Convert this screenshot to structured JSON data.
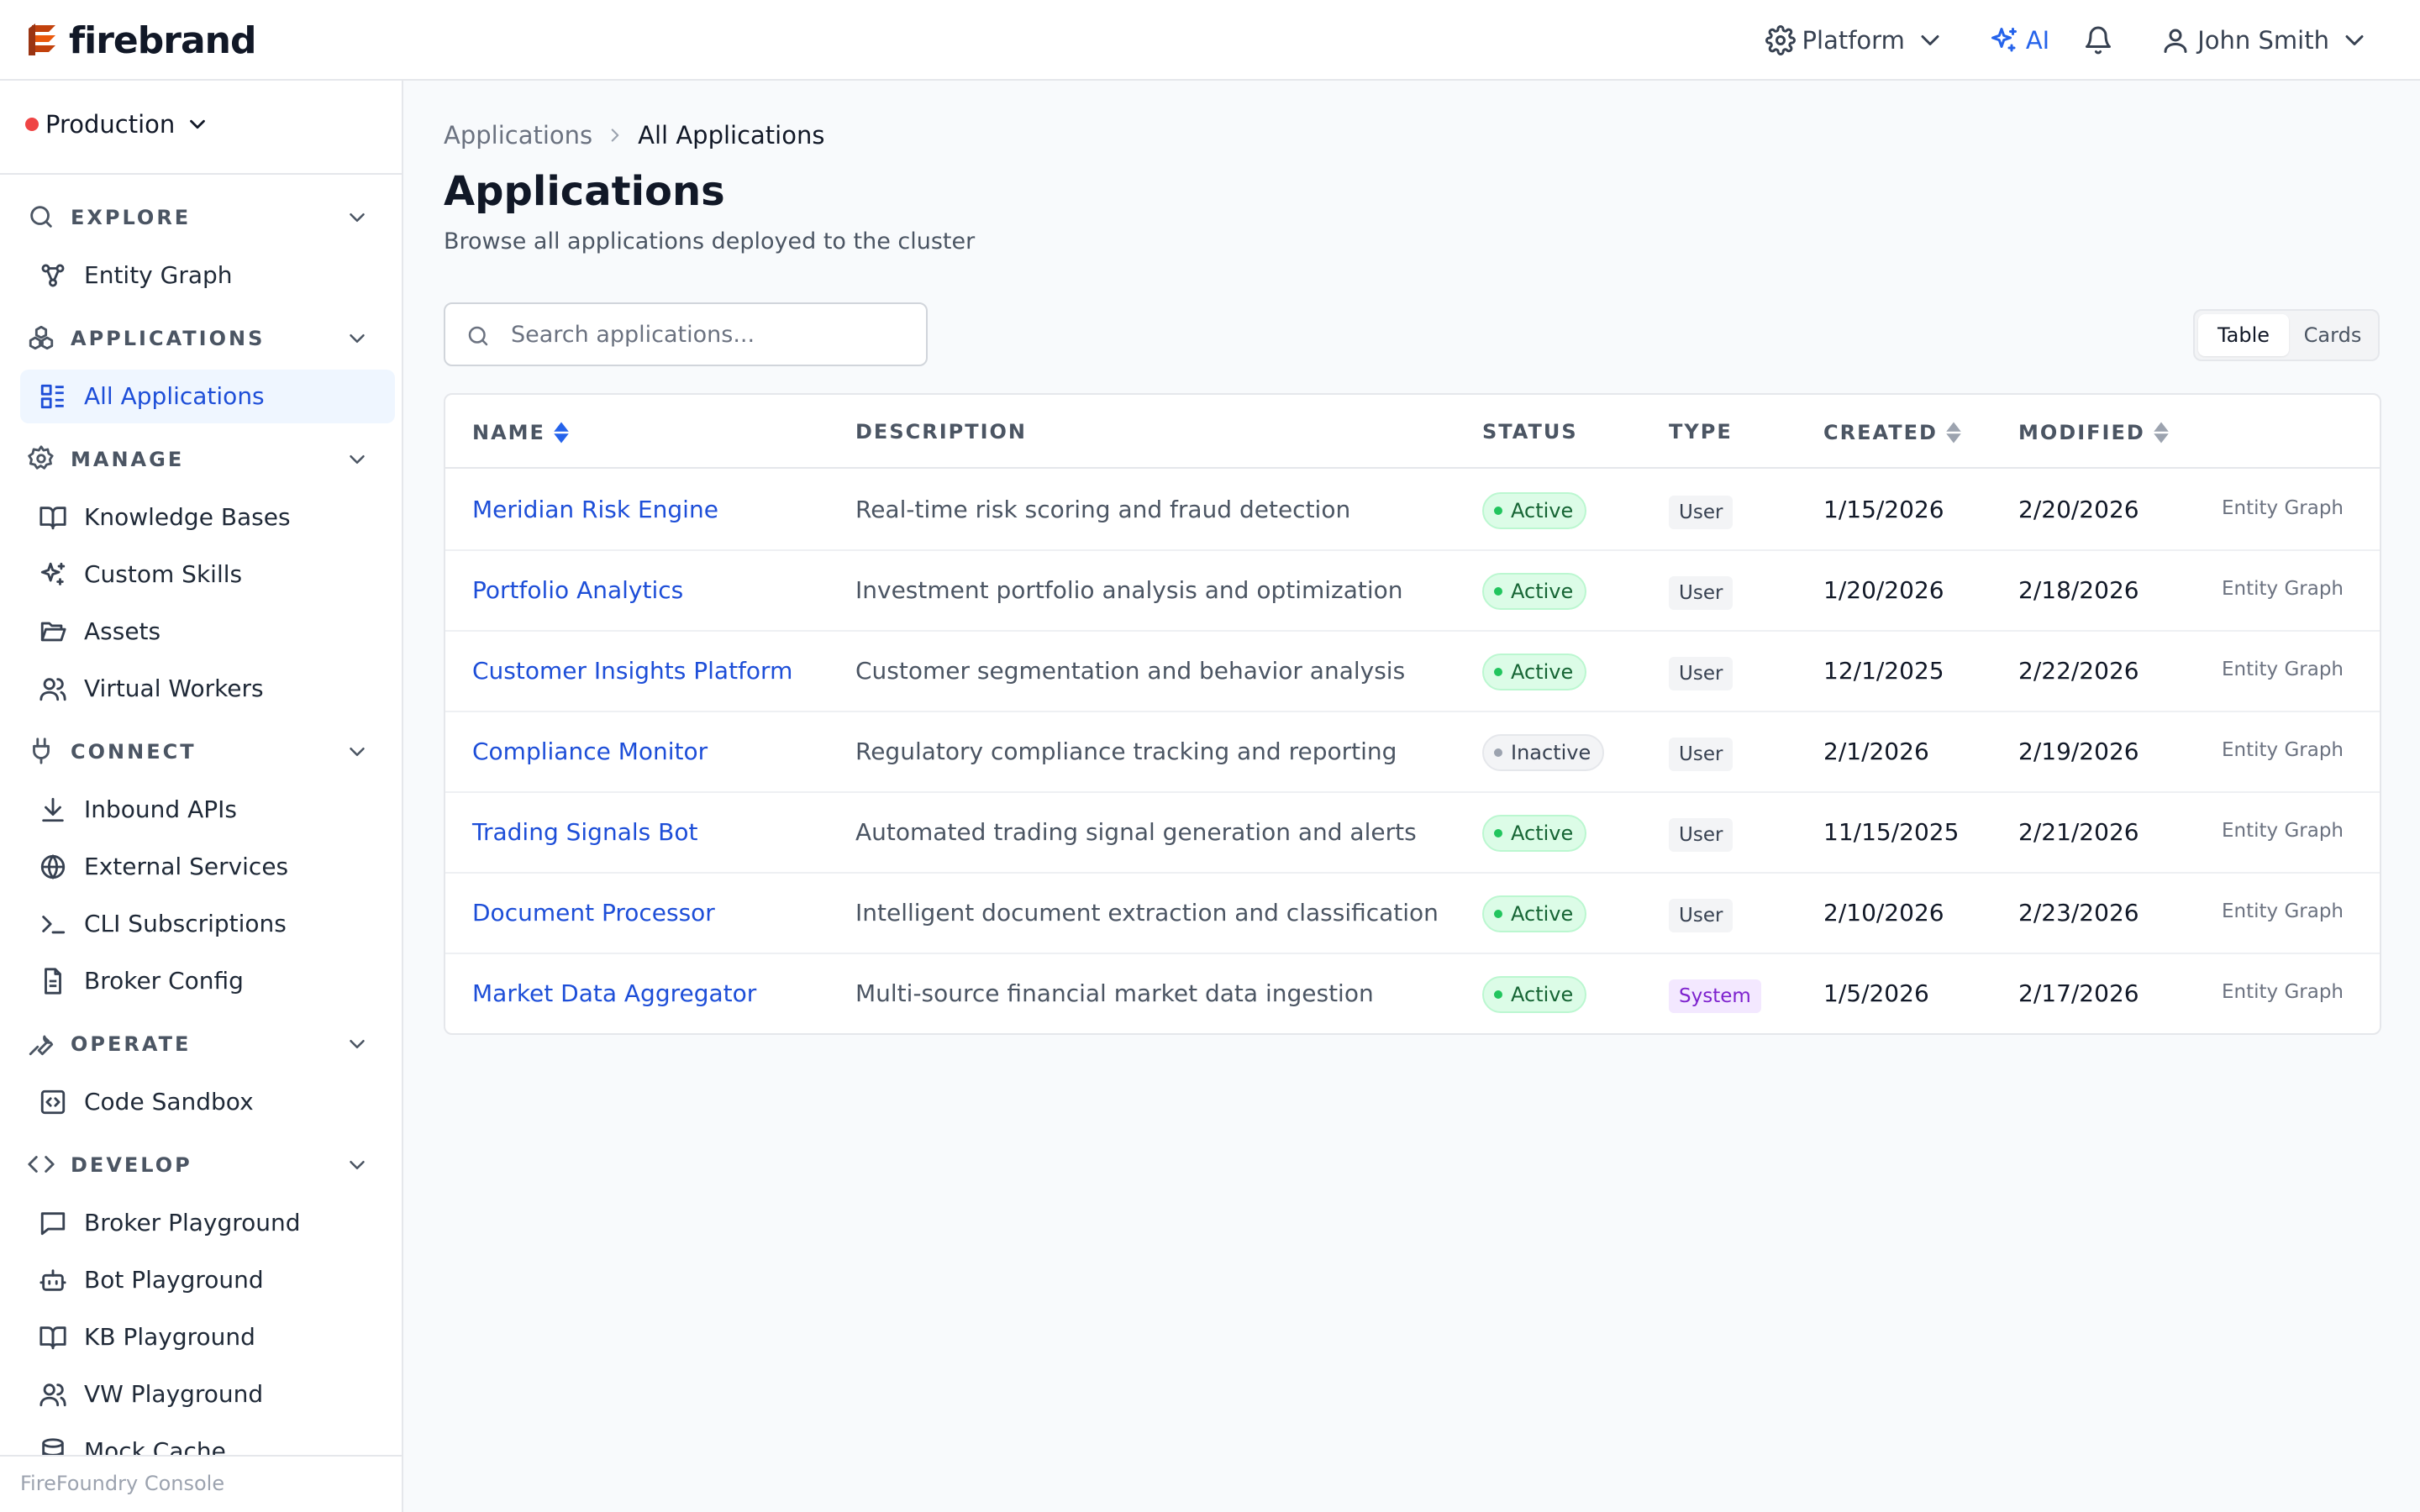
{
  "header": {
    "logo_text": "firebrand",
    "platform_label": "Platform",
    "ai_label": "AI",
    "user_name": "John Smith",
    "accent_color": "#2563eb",
    "logo_color": "#c2410c"
  },
  "sidebar": {
    "environment": "Production",
    "environment_status_color": "#ef4444",
    "sections": {
      "explore": "EXPLORE",
      "applications": "APPLICATIONS",
      "manage": "MANAGE",
      "connect": "CONNECT",
      "operate": "OPERATE",
      "develop": "DEVELOP"
    },
    "items": {
      "entity_graph": "Entity Graph",
      "all_applications": "All Applications",
      "knowledge_bases": "Knowledge Bases",
      "custom_skills": "Custom Skills",
      "assets": "Assets",
      "virtual_workers": "Virtual Workers",
      "inbound_apis": "Inbound APIs",
      "external_services": "External Services",
      "cli_subscriptions": "CLI Subscriptions",
      "broker_config": "Broker Config",
      "code_sandbox": "Code Sandbox",
      "broker_playground": "Broker Playground",
      "bot_playground": "Bot Playground",
      "kb_playground": "KB Playground",
      "vw_playground": "VW Playground",
      "mock_cache": "Mock Cache"
    },
    "footer": "FireFoundry Console"
  },
  "main": {
    "breadcrumb": [
      "Applications",
      "All Applications"
    ],
    "title": "Applications",
    "subtitle": "Browse all applications deployed to the cluster",
    "search_placeholder": "Search applications...",
    "view_toggle": {
      "table": "Table",
      "cards": "Cards",
      "selected": "Table"
    },
    "table": {
      "columns": {
        "name": "NAME",
        "description": "DESCRIPTION",
        "status": "STATUS",
        "type": "TYPE",
        "created": "CREATED",
        "modified": "MODIFIED"
      },
      "sort": {
        "column": "NAME",
        "direction": "ascending"
      },
      "rows": [
        {
          "name": "Meridian Risk Engine",
          "description": "Real-time risk scoring and fraud detection",
          "status": "Active",
          "type": "User",
          "created": "1/15/2026",
          "modified": "2/20/2026",
          "link": "Entity Graph"
        },
        {
          "name": "Portfolio Analytics",
          "description": "Investment portfolio analysis and optimization",
          "status": "Active",
          "type": "User",
          "created": "1/20/2026",
          "modified": "2/18/2026",
          "link": "Entity Graph"
        },
        {
          "name": "Customer Insights Platform",
          "description": "Customer segmentation and behavior analysis",
          "status": "Active",
          "type": "User",
          "created": "12/1/2025",
          "modified": "2/22/2026",
          "link": "Entity Graph"
        },
        {
          "name": "Compliance Monitor",
          "description": "Regulatory compliance tracking and reporting",
          "status": "Inactive",
          "type": "User",
          "created": "2/1/2026",
          "modified": "2/19/2026",
          "link": "Entity Graph"
        },
        {
          "name": "Trading Signals Bot",
          "description": "Automated trading signal generation and alerts",
          "status": "Active",
          "type": "User",
          "created": "11/15/2025",
          "modified": "2/21/2026",
          "link": "Entity Graph"
        },
        {
          "name": "Document Processor",
          "description": "Intelligent document extraction and classification",
          "status": "Active",
          "type": "User",
          "created": "2/10/2026",
          "modified": "2/23/2026",
          "link": "Entity Graph"
        },
        {
          "name": "Market Data Aggregator",
          "description": "Multi-source financial market data ingestion",
          "status": "Active",
          "type": "System",
          "created": "1/5/2026",
          "modified": "2/17/2026",
          "link": "Entity Graph"
        }
      ]
    }
  }
}
